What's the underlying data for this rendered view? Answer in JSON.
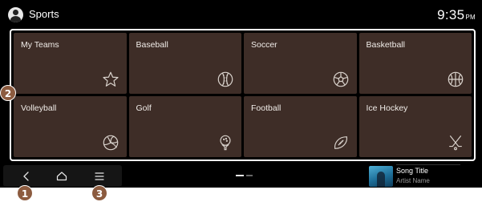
{
  "header": {
    "title": "Sports",
    "time": "9:35",
    "ampm": "PM"
  },
  "tiles": [
    {
      "label": "My Teams",
      "icon": "star-icon"
    },
    {
      "label": "Baseball",
      "icon": "baseball-icon"
    },
    {
      "label": "Soccer",
      "icon": "soccer-ball-icon"
    },
    {
      "label": "Basketball",
      "icon": "basketball-icon"
    },
    {
      "label": "Volleyball",
      "icon": "volleyball-icon"
    },
    {
      "label": "Golf",
      "icon": "golf-ball-on-tee-icon"
    },
    {
      "label": "Football",
      "icon": "football-icon"
    },
    {
      "label": "Ice Hockey",
      "icon": "hockey-sticks-icon"
    }
  ],
  "callouts": {
    "back": "1",
    "grid": "2",
    "menu": "3"
  },
  "nav": {
    "back_icon": "back-arrow-icon",
    "home_icon": "home-icon",
    "menu_icon": "menu-icon"
  },
  "now_playing": {
    "song_title": "Song Title",
    "artist": "Artist Name"
  },
  "colors": {
    "tile_bg": "#3e2d27",
    "callout": "#8c5b3f",
    "screen_bg": "#000000"
  }
}
